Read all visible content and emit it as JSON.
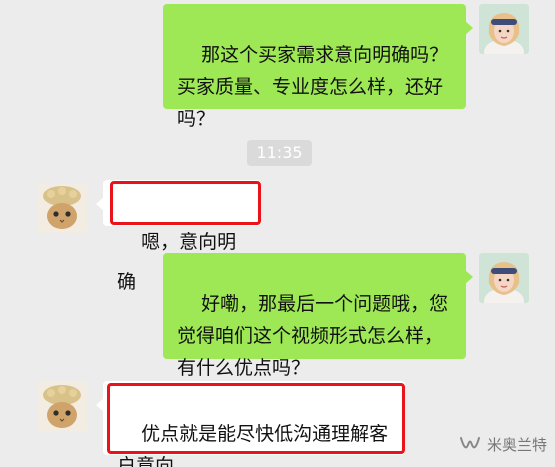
{
  "chat": {
    "messages": [
      {
        "id": "m1",
        "side": "outgoing",
        "text": "那这个买家需求意向明确吗？买家质量、专业度怎么样，还好吗？"
      },
      {
        "id": "m2",
        "side": "incoming",
        "text": "嗯，意向明确",
        "highlighted": true
      },
      {
        "id": "m3",
        "side": "outgoing",
        "text": "好嘞，那最后一个问题哦，您觉得咱们这个视频形式怎么样，有什么优点吗？"
      },
      {
        "id": "m4",
        "side": "incoming",
        "text": "优点就是能尽快低沟通理解客户意向",
        "highlighted": true
      }
    ],
    "timestamp": "11:35"
  },
  "watermark": {
    "text": "米奥兰特",
    "icon": "wechat-channel-icon"
  },
  "colors": {
    "background": "#ececec",
    "outgoing_bubble": "#9ee755",
    "incoming_bubble": "#ffffff",
    "highlight_border": "#e8141a",
    "time_badge": "#dadada"
  },
  "icons": {
    "self_avatar": "avatar-girl-headband-icon",
    "other_avatar": "avatar-cat-hat-icon"
  }
}
